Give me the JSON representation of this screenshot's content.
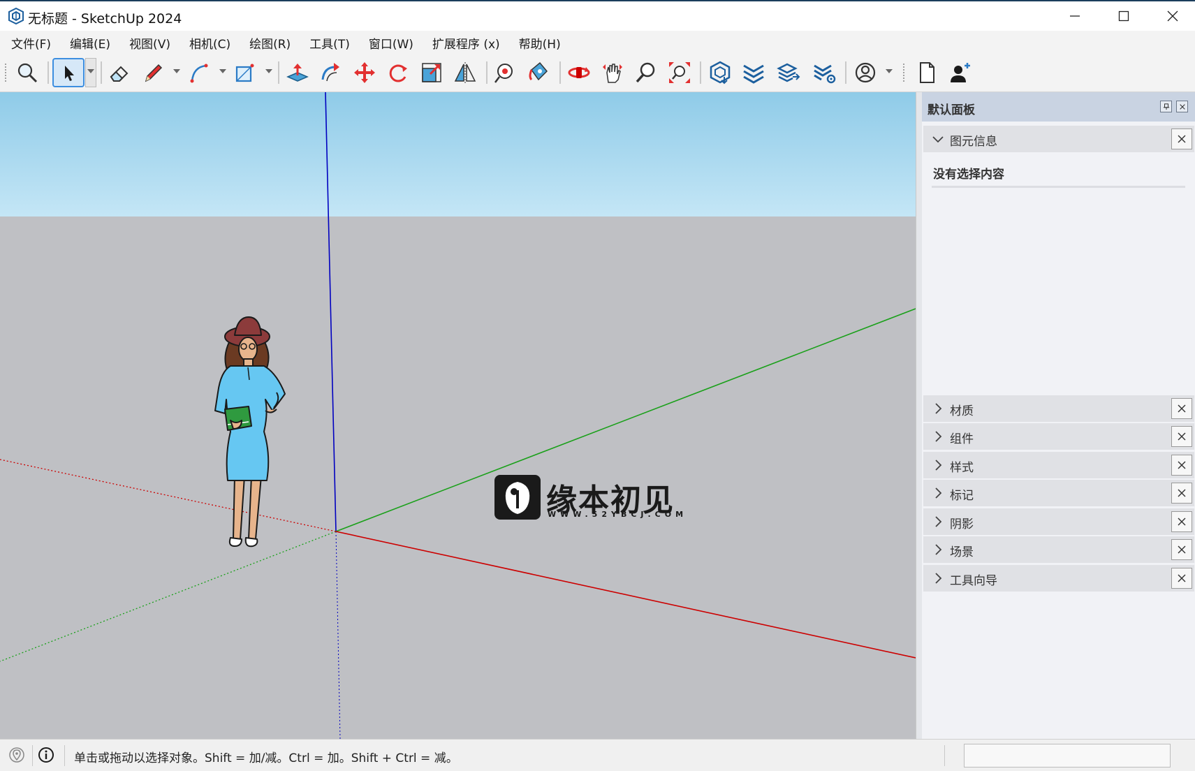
{
  "window": {
    "title": "无标题 - SketchUp 2024"
  },
  "menu": [
    "文件(F)",
    "编辑(E)",
    "视图(V)",
    "相机(C)",
    "绘图(R)",
    "工具(T)",
    "窗口(W)",
    "扩展程序 (x)",
    "帮助(H)"
  ],
  "toolbar": {
    "tools": [
      "search-icon",
      "select-arrow-icon",
      "eraser-icon",
      "pencil-icon",
      "arc-icon",
      "rectangle-icon",
      "push-pull-icon",
      "follow-me-icon",
      "move-icon",
      "rotate-icon",
      "scale-icon",
      "mirror-icon",
      "tape-measure-icon",
      "paint-bucket-icon",
      "orbit-icon",
      "pan-icon",
      "zoom-icon",
      "zoom-extents-icon",
      "warehouse-icon",
      "extension-warehouse-icon",
      "layout-send-icon",
      "extension-manager-icon",
      "user-account-icon",
      "new-file-icon",
      "add-user-icon"
    ]
  },
  "watermark": {
    "title": "缘本初见",
    "subtitle": "WWW.52YBCJ.COM"
  },
  "colors": {
    "sky_top": "#8fcbe8",
    "sky_bottom": "#c4e6f6",
    "ground": "#bfc0c4",
    "axis_red": "#cc0000",
    "axis_green": "#1aa01a",
    "axis_blue": "#0000c0",
    "panel_header": "#c9d3e2",
    "accent": "#3d8ee0"
  },
  "panel": {
    "title": "默认面板",
    "entity_info": {
      "label": "图元信息",
      "empty_text": "没有选择内容"
    },
    "trays": [
      "材质",
      "组件",
      "样式",
      "标记",
      "阴影",
      "场景",
      "工具向导"
    ]
  },
  "status": {
    "message": "单击或拖动以选择对象。Shift = 加/减。Ctrl = 加。Shift + Ctrl = 减。",
    "measurement": ""
  }
}
